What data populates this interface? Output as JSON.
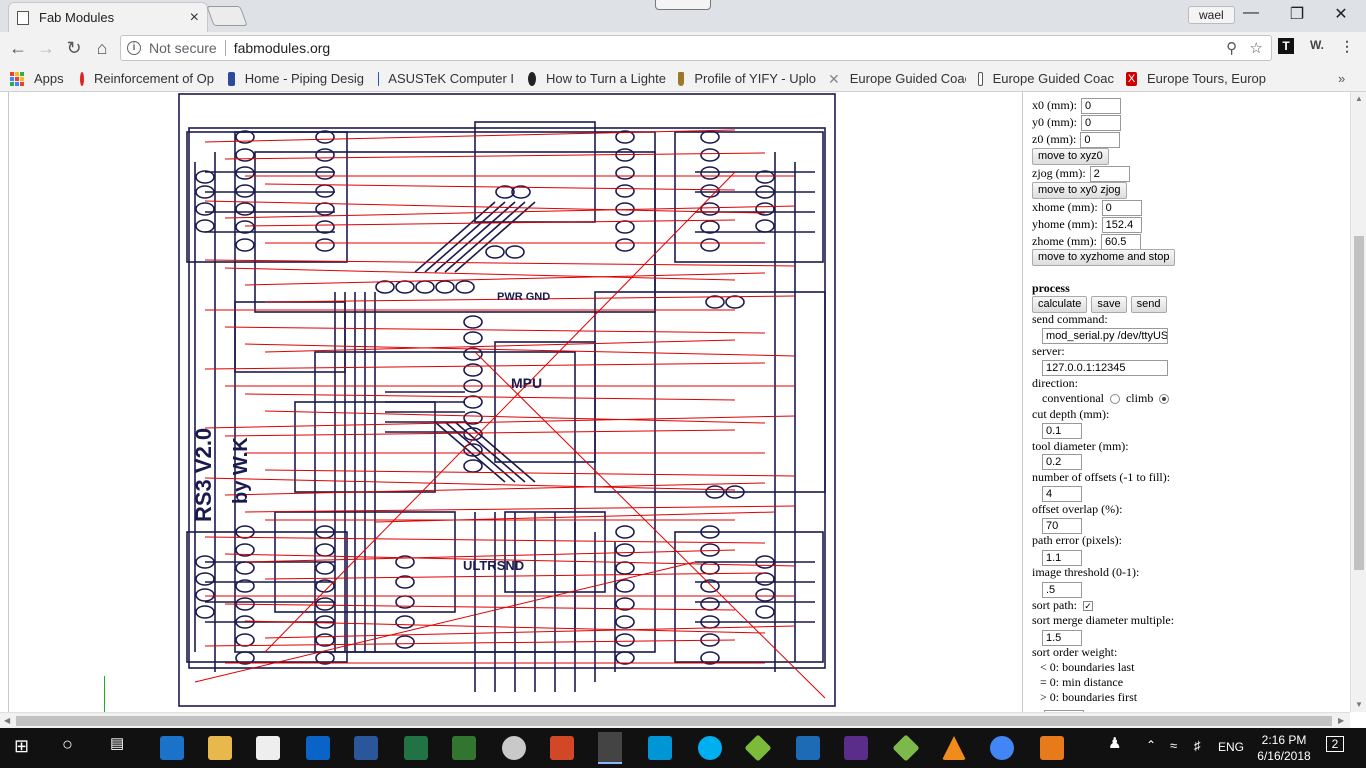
{
  "browser": {
    "tab_title": "Fab Modules",
    "tab_close": "×",
    "profile_name": "wael",
    "security_label": "Not secure",
    "url": "fabmodules.org",
    "ext_t": "T",
    "ext_w": "W."
  },
  "bookmarks": [
    {
      "label": "Apps",
      "icon": "apps-grid-icon"
    },
    {
      "label": "Reinforcement of Op",
      "icon": "c-logo-icon",
      "color": "#d22"
    },
    {
      "label": "Home - Piping Desig",
      "icon": "piping-icon",
      "color": "#2c4a9b"
    },
    {
      "label": "ASUSTeK Computer I",
      "icon": "asus-icon",
      "color": "#1d5bb8"
    },
    {
      "label": "How to Turn a Lighte",
      "icon": "instructables-icon",
      "color": "#222"
    },
    {
      "label": "Profile of YIFY - Uplo",
      "icon": "yify-icon",
      "color": "#9a7a2a"
    },
    {
      "label": "Europe Guided Coach",
      "icon": "cross-icon",
      "color": "#888"
    },
    {
      "label": "Europe Guided Coac",
      "icon": "page-icon",
      "color": "#fff"
    },
    {
      "label": "Europe Tours, Europ",
      "icon": "x-red-icon",
      "color": "#c00"
    }
  ],
  "panel": {
    "x0_label": "x0 (mm):",
    "x0": "0",
    "y0_label": "y0 (mm):",
    "y0": "0",
    "z0_label": "z0 (mm):",
    "z0": "0",
    "move_xyz0": "move to xyz0",
    "zjog_label": "zjog (mm):",
    "zjog": "2",
    "move_xy0_zjog": "move to xy0 zjog",
    "xhome_label": "xhome (mm):",
    "xhome": "0",
    "yhome_label": "yhome (mm):",
    "yhome": "152.4",
    "zhome_label": "zhome (mm):",
    "zhome": "60.5",
    "move_home": "move to xyzhome and stop",
    "process_heading": "process",
    "calculate": "calculate",
    "save": "save",
    "send": "send",
    "send_command_label": "send command:",
    "send_command": "mod_serial.py /dev/ttyUSB",
    "server_label": "server:",
    "server": "127.0.0.1:12345",
    "direction_label": "direction:",
    "conventional": "conventional",
    "climb": "climb",
    "cut_depth_label": "cut depth (mm):",
    "cut_depth": "0.1",
    "tool_diameter_label": "tool diameter (mm):",
    "tool_diameter": "0.2",
    "offsets_label": "number of offsets (-1 to fill):",
    "offsets": "4",
    "overlap_label": "offset overlap (%):",
    "overlap": "70",
    "path_error_label": "path error (pixels):",
    "path_error": "1.1",
    "threshold_label": "image threshold (0-1):",
    "threshold": ".5",
    "sort_path_label": "sort path:",
    "sort_merge_label": "sort merge diameter multiple:",
    "sort_merge": "1.5",
    "sort_order_label": "sort order weight:",
    "order_last": "< 0: boundaries last",
    "order_min": "= 0: min distance",
    "order_first": "> 0: boundaries first"
  },
  "pcb_text": {
    "board_name": "RS3 V2.0",
    "author": "by W.K",
    "mpu": "MPU",
    "ultrasnd": "ULTRSND",
    "port_name": "PWR GND"
  },
  "taskbar": {
    "time": "2:16 PM",
    "date": "6/16/2018",
    "lang": "ENG",
    "notifications": "2"
  },
  "colors": {
    "trace": "#1a1a4e",
    "toolpath": "#e00000"
  }
}
